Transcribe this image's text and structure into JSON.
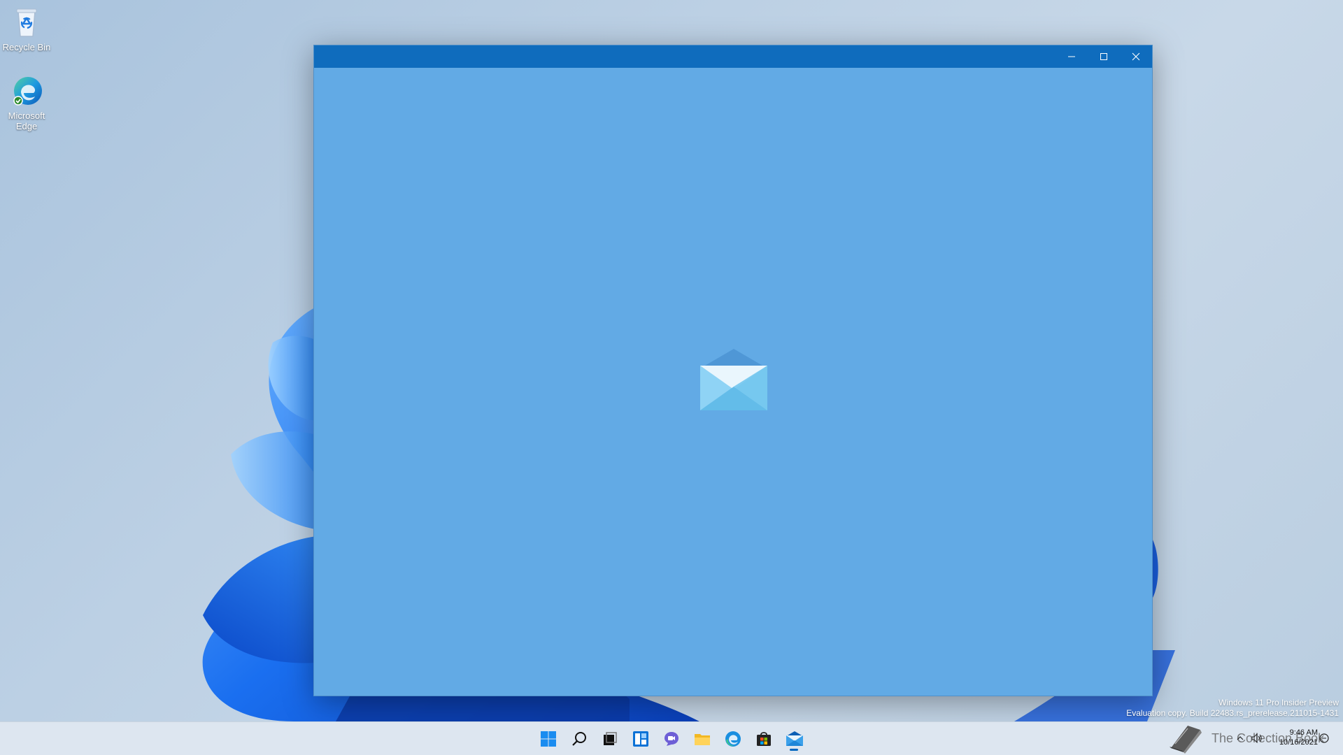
{
  "desktop": {
    "icons": [
      {
        "label": "Recycle Bin",
        "icon": "recycle-bin-icon"
      },
      {
        "label": "Microsoft Edge",
        "icon": "edge-icon"
      }
    ]
  },
  "window": {
    "app": "Mail",
    "splash_icon": "mail-envelope-icon",
    "controls": [
      "minimize-icon",
      "maximize-icon",
      "close-icon"
    ],
    "background_color": "#62aae5",
    "titlebar_color": "#0f6cbd"
  },
  "taskbar": {
    "items": [
      "start-icon",
      "search-icon",
      "task-view-icon",
      "widgets-icon",
      "chat-icon",
      "file-explorer-icon",
      "edge-icon",
      "store-icon",
      "mail-icon"
    ],
    "active_item": "mail-icon"
  },
  "watermark": {
    "line1": "Windows 11 Pro Insider Preview",
    "line2": "Evaluation copy. Build 22483.rs_prerelease.211015-1431"
  },
  "brand": {
    "text": "The Collection Book"
  },
  "tray": {
    "time": "9:46 AM",
    "date": "10/16/2021"
  },
  "accent_color": "#0067c0"
}
